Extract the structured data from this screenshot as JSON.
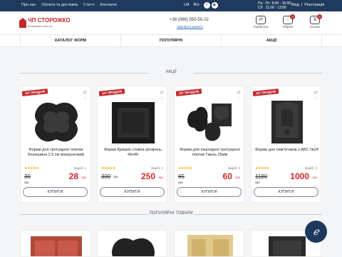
{
  "topbar": {
    "links": [
      "Про нас",
      "Оплата та доставка",
      "Статті",
      "Контакти"
    ],
    "languages": [
      "UA",
      "RU"
    ],
    "hours_line1": "Пн - Пт: 9:00 - 16:00",
    "hours_line2": "Сб : 11:00 - 13:00",
    "login": "Вхід",
    "separator": "|",
    "register": "Реєстрація"
  },
  "header": {
    "logo_name": "ЧП СТОРОЖКО",
    "logo_site": "formfortree.com.ua",
    "phone": "+38 (066) 555-55-22",
    "callback": "Замовити дзвінок",
    "icons": [
      {
        "name": "compare-icon",
        "label": "Порівняти",
        "badge": ""
      },
      {
        "name": "wishlist-icon",
        "label": "Обрані",
        "badge": "0"
      },
      {
        "name": "cart-icon",
        "label": "Кошик",
        "badge": "0"
      }
    ]
  },
  "nav": [
    "КАТАЛОГ ФОРМ",
    "ПОПУЛЯРНІ",
    "АКЦІЇ"
  ],
  "sections": {
    "sale": "АКЦІЇ",
    "popular": "ПОПУЛЯРНІ ТОВАРИ"
  },
  "products": [
    {
      "badge": "ХІТ ПРОДАЖ",
      "title": "Форми для тротуарної плитки Конюшина 2,5 см візерунковий",
      "stars": "★★★★★",
      "code": "Виріб: 1",
      "old_price": "30",
      "old_currency": "грн",
      "price": "28",
      "currency": "грн",
      "button": "КУПИТИ"
    },
    {
      "badge": "ХІТ ПРОДАЖ",
      "title": "Форма Кришок стовпа крокрень 49х49",
      "stars": "★★★★★",
      "code": "Виріб: 2",
      "old_price": "300",
      "old_currency": "грн",
      "price": "250",
      "currency": "грн",
      "button": "КУПИТИ"
    },
    {
      "badge": "ХІТ ПРОДАЖ",
      "title": "Форми для пішохідної тротуарної плитки Гжель 25мм",
      "stars": "★★★★★",
      "code": "Виріб: 3",
      "old_price": "65",
      "old_currency": "грн",
      "price": "60",
      "currency": "грн",
      "button": "КУПИТИ"
    },
    {
      "badge": "ХІТ ПРОДАЖ",
      "title": "Форми для пам'ятників з АБС №24",
      "stars": "★★★★★",
      "code": "Виріб: 2",
      "old_price": "1180",
      "old_currency": "грн",
      "price": "1000",
      "currency": "грн",
      "button": "КУПИТИ"
    }
  ],
  "colors": {
    "topbar": "#1f3a5c",
    "accent": "#c2272d",
    "price": "#d6262b",
    "chat": "#1d3a5d"
  }
}
